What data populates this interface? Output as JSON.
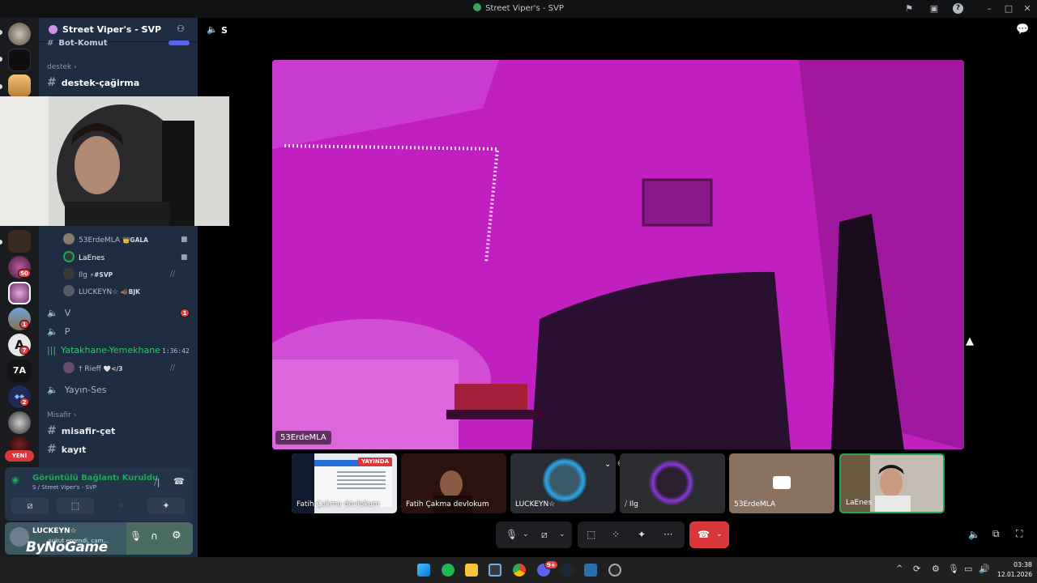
{
  "window": {
    "title": "Street Viper's - SVP"
  },
  "server": {
    "name": "Street Viper's - SVP",
    "chevron": "chevron-down-icon"
  },
  "channels": {
    "cut_top": "Bot-Komut",
    "cut_top_badge": "YENİ",
    "category_destek": "destek",
    "destek_cagirma": "destek-çağirma",
    "voice_users": [
      {
        "name": "53ErdeMLA",
        "tag": "👑GALA"
      },
      {
        "name": "LaEnes",
        "tag": ""
      },
      {
        "name": "Ilg",
        "tag": "⚡#SVP"
      },
      {
        "name": "LUCKEYN☆",
        "tag": "🐗BJK"
      }
    ],
    "voice_v": "V",
    "voice_v_badge": "1",
    "voice_p": "P",
    "voice_yatakhane": "Yatakhane-Yemekhane",
    "yatakhane_timer": "1:36:42",
    "yatakhane_user": "† Rieff",
    "yatakhane_user_tag": "🤍</3",
    "voice_yayin": "Yayın-Ses",
    "category_misafir": "Misafir",
    "misafir_cet": "misafir-çet",
    "kayit": "kayıt"
  },
  "rail": {
    "badges": [
      "50",
      "1",
      "7",
      "2"
    ],
    "new_label": "YENİ"
  },
  "voice_status": {
    "title": "Görüntülü Bağlantı Kuruldu",
    "subtitle": "S / Street Viper's - SVP"
  },
  "user": {
    "name": "LUCKEYN☆",
    "status": "sukut eprendi, cam...",
    "watermark": "ByNoGame"
  },
  "stage": {
    "channel_name": "S",
    "main_label": "53ErdeMLA",
    "tiles": [
      {
        "label": "Fatih Çakma devlokum",
        "live": "YAYINDA"
      },
      {
        "label": "Fatih Çakma devlokum"
      },
      {
        "label": "LUCKEYN☆"
      },
      {
        "label": "Ilg"
      },
      {
        "label": "53ErdeMLA"
      },
      {
        "label": "LaEnes"
      }
    ]
  },
  "taskbar": {
    "time": "03:38",
    "date": "12.01.2026",
    "discord_badge": "9+"
  },
  "colors": {
    "accent_green": "#23a55a",
    "hangup": "#da373c",
    "main_video": "#c21fc0"
  }
}
